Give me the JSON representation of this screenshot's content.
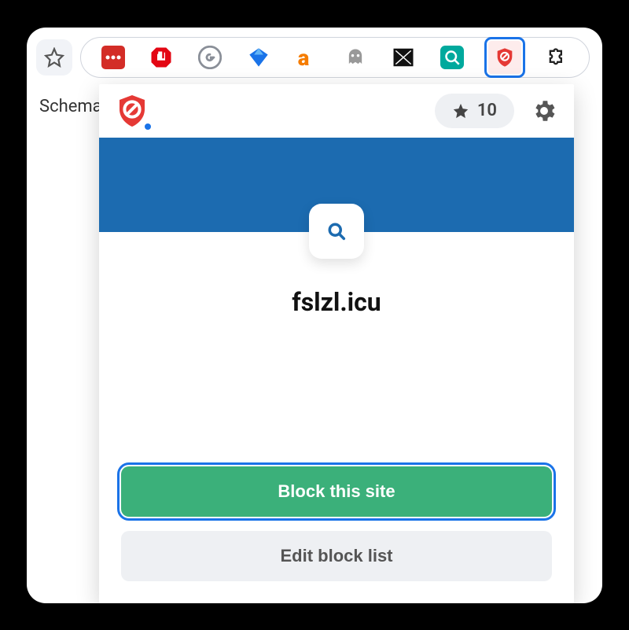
{
  "page": {
    "partial_label": "Schema"
  },
  "extensions": [
    {
      "name": "lastpass",
      "color": "#d32d27"
    },
    {
      "name": "adblock",
      "color": "#e30613"
    },
    {
      "name": "grammarly",
      "color": "#8a8f98"
    },
    {
      "name": "blue-funnel",
      "color": "#1a73e8"
    },
    {
      "name": "ahrefs",
      "color": "#f57c00"
    },
    {
      "name": "ghost",
      "color": "#777"
    },
    {
      "name": "stripe-flag",
      "color": "#111"
    },
    {
      "name": "cyan-search",
      "color": "#00a99d"
    },
    {
      "name": "blocksite-active",
      "color": "#e53935"
    },
    {
      "name": "puzzle",
      "color": "#222"
    }
  ],
  "popup": {
    "stats": {
      "count": "10"
    },
    "domain": "fslzl.icu",
    "buttons": {
      "primary": "Block this site",
      "secondary": "Edit block list"
    }
  }
}
